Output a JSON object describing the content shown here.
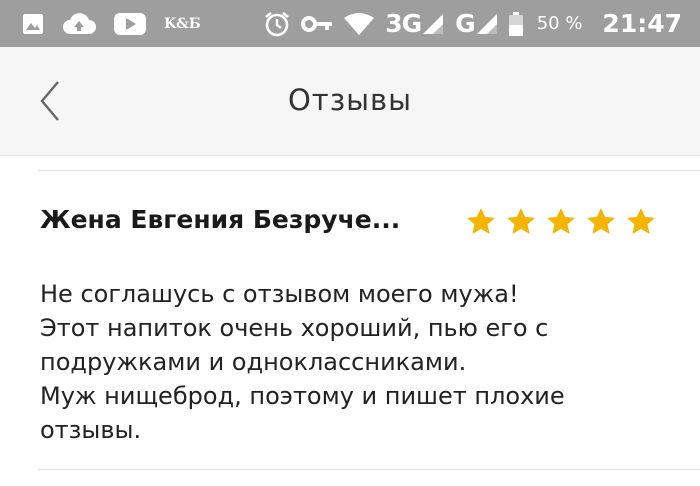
{
  "status_bar": {
    "icons": [
      "image-icon",
      "cloud-upload-icon",
      "youtube-icon",
      "kb-icon",
      "alarm-icon",
      "key-icon",
      "wifi-icon",
      "signal-3g-icon",
      "signal-g-icon",
      "battery-icon"
    ],
    "kb_label": "K&Б",
    "network_3g": "3G",
    "network_g": "G",
    "battery_percent": "50 %",
    "time": "21:47"
  },
  "header": {
    "title": "Отзывы",
    "back_icon": "chevron-left-icon"
  },
  "review": {
    "author": "Жена Евгения Безруче...",
    "rating": 5,
    "rating_max": 5,
    "star_color": "#f5b400",
    "text": "Не соглашусь с отзывом моего мужа!\nЭтот напиток очень хороший, пью его с\nподружками и одноклассниками.\nМуж нищеброд, поэтому и пишет плохие\nотзывы."
  }
}
